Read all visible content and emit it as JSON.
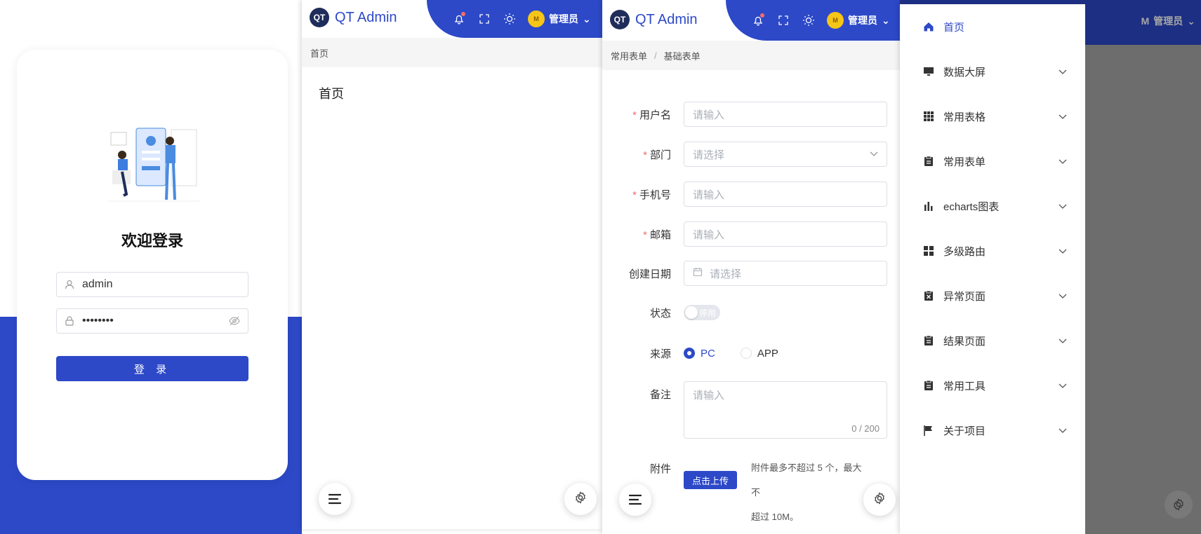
{
  "login": {
    "welcome": "欢迎登录",
    "username_value": "admin",
    "password_mask": "••••••••",
    "login_button": "登 录"
  },
  "header": {
    "logo_mark": "QT",
    "app_name": "QT Admin",
    "user_name": "管理员"
  },
  "home_panel": {
    "breadcrumb": "首页",
    "title": "首页"
  },
  "form_panel": {
    "breadcrumb": [
      "常用表单",
      "基础表单"
    ],
    "fields": [
      {
        "label": "用户名",
        "required": true,
        "placeholder": "请输入"
      },
      {
        "label": "部门",
        "required": true,
        "placeholder": "请选择"
      },
      {
        "label": "手机号",
        "required": true,
        "placeholder": "请输入"
      },
      {
        "label": "邮箱",
        "required": true,
        "placeholder": "请输入"
      },
      {
        "label": "创建日期",
        "required": false,
        "placeholder": "请选择"
      }
    ],
    "status_label": "状态",
    "status_switch_text": "停用",
    "source_label": "来源",
    "source_options": [
      "PC",
      "APP"
    ],
    "source_selected": "PC",
    "remark_label": "备注",
    "remark_placeholder": "请输入",
    "remark_counter": "0 / 200",
    "attachment_label": "附件",
    "upload_button": "点击上传",
    "upload_tip_1": "附件最多不超过 5 个，最大不",
    "upload_tip_2": "超过 10M。",
    "required_mark": "*"
  },
  "menu": {
    "items": [
      {
        "label": "首页",
        "icon": "home-icon",
        "active": true,
        "has_children": false
      },
      {
        "label": "数据大屏",
        "icon": "monitor-icon",
        "active": false,
        "has_children": true
      },
      {
        "label": "常用表格",
        "icon": "grid-icon",
        "active": false,
        "has_children": true
      },
      {
        "label": "常用表单",
        "icon": "clipboard-icon",
        "active": false,
        "has_children": true
      },
      {
        "label": "echarts图表",
        "icon": "bar-chart-icon",
        "active": false,
        "has_children": true
      },
      {
        "label": "多级路由",
        "icon": "apps-icon",
        "active": false,
        "has_children": true
      },
      {
        "label": "异常页面",
        "icon": "error-doc-icon",
        "active": false,
        "has_children": true
      },
      {
        "label": "结果页面",
        "icon": "clipboard-icon",
        "active": false,
        "has_children": true
      },
      {
        "label": "常用工具",
        "icon": "clipboard-icon",
        "active": false,
        "has_children": true
      },
      {
        "label": "关于项目",
        "icon": "flag-icon",
        "active": false,
        "has_children": true
      }
    ]
  },
  "colors": {
    "primary": "#2d49c8",
    "danger": "#f56c6c"
  }
}
